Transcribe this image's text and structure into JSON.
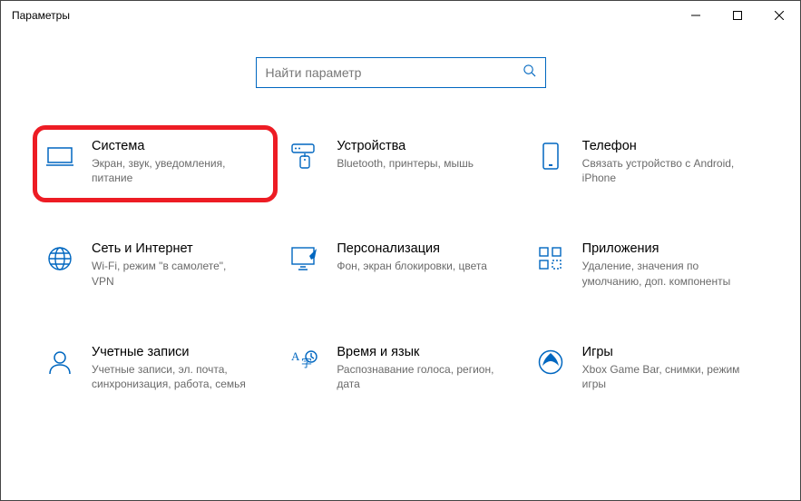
{
  "window": {
    "title": "Параметры"
  },
  "search": {
    "placeholder": "Найти параметр"
  },
  "tiles": {
    "system": {
      "title": "Система",
      "desc": "Экран, звук, уведомления, питание"
    },
    "devices": {
      "title": "Устройства",
      "desc": "Bluetooth, принтеры, мышь"
    },
    "phone": {
      "title": "Телефон",
      "desc": "Связать устройство с Android, iPhone"
    },
    "network": {
      "title": "Сеть и Интернет",
      "desc": "Wi-Fi, режим \"в самолете\", VPN"
    },
    "personalize": {
      "title": "Персонализация",
      "desc": "Фон, экран блокировки, цвета"
    },
    "apps": {
      "title": "Приложения",
      "desc": "Удаление, значения по умолчанию, доп. компоненты"
    },
    "accounts": {
      "title": "Учетные записи",
      "desc": "Учетные записи, эл. почта, синхронизация, работа, семья"
    },
    "time": {
      "title": "Время и язык",
      "desc": "Распознавание голоса, регион, дата"
    },
    "gaming": {
      "title": "Игры",
      "desc": "Xbox Game Bar, снимки, режим игры"
    }
  },
  "highlight_tile": "system",
  "colors": {
    "accent": "#0067c0",
    "highlight": "#ed1c24"
  }
}
